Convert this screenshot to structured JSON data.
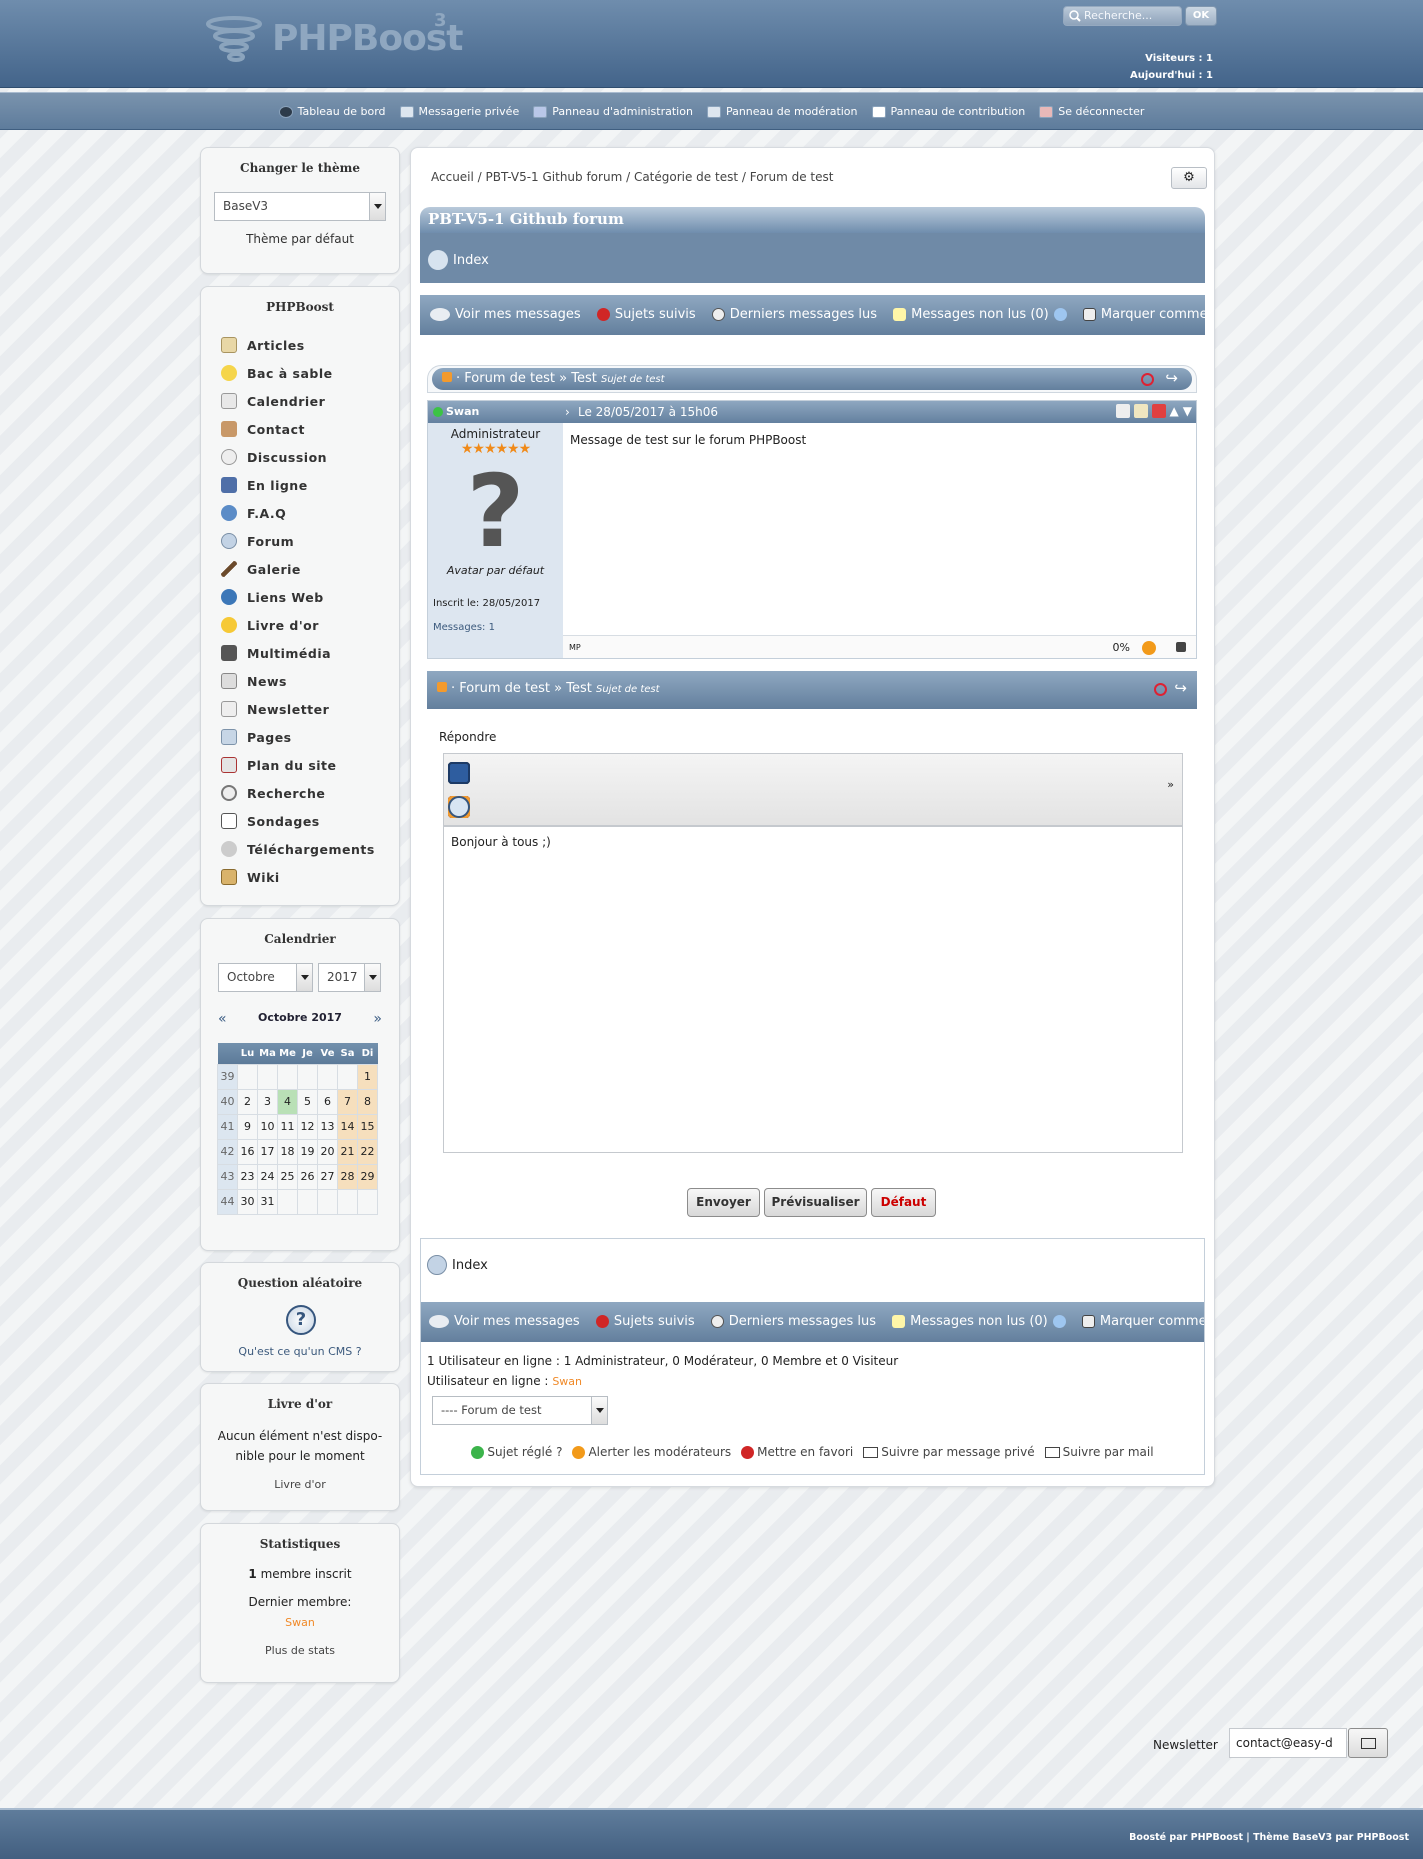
{
  "header": {
    "logo_text": "PHPBoost",
    "logo_sup": "3",
    "search_placeholder": "Recherche...",
    "search_button": "OK",
    "visitors": "Visiteurs : 1",
    "today": "Aujourd'hui : 1"
  },
  "menu": [
    {
      "label": "Tableau de bord",
      "icon": "dashboard-icon"
    },
    {
      "label": "Messagerie privée",
      "icon": "envelope-icon"
    },
    {
      "label": "Panneau d'administration",
      "icon": "admin-icon"
    },
    {
      "label": "Panneau de modération",
      "icon": "moderation-icon"
    },
    {
      "label": "Panneau de contribution",
      "icon": "contribution-icon"
    },
    {
      "label": "Se déconnecter",
      "icon": "logout-icon"
    }
  ],
  "theme_box": {
    "title": "Changer le thème",
    "selected": "BaseV3",
    "default_link": "Thème par défaut"
  },
  "nav_box": {
    "title": "PHPBoost",
    "items": [
      "Articles",
      "Bac à sable",
      "Calendrier",
      "Contact",
      "Discussion",
      "En ligne",
      "F.A.Q",
      "Forum",
      "Galerie",
      "Liens Web",
      "Livre d'or",
      "Multimédia",
      "News",
      "Newsletter",
      "Pages",
      "Plan du site",
      "Recherche",
      "Sondages",
      "Téléchargements",
      "Wiki"
    ]
  },
  "calendar": {
    "title": "Calendrier",
    "month_select": "Octobre",
    "year_select": "2017",
    "caption": "Octobre 2017",
    "prev": "«",
    "next": "»",
    "days": [
      "Lu",
      "Ma",
      "Me",
      "Je",
      "Ve",
      "Sa",
      "Di"
    ],
    "weeks": [
      [
        "39",
        "",
        "",
        "",
        "",
        "",
        "",
        "1"
      ],
      [
        "40",
        "2",
        "3",
        "4",
        "5",
        "6",
        "7",
        "8"
      ],
      [
        "41",
        "9",
        "10",
        "11",
        "12",
        "13",
        "14",
        "15"
      ],
      [
        "42",
        "16",
        "17",
        "18",
        "19",
        "20",
        "21",
        "22"
      ],
      [
        "43",
        "23",
        "24",
        "25",
        "26",
        "27",
        "28",
        "29"
      ],
      [
        "44",
        "30",
        "31",
        "",
        "",
        "",
        "",
        ""
      ]
    ]
  },
  "question_box": {
    "title": "Question aléatoire",
    "question": "Qu'est ce qu'un CMS ?"
  },
  "guestbook_box": {
    "title": "Livre d'or",
    "text1": "Aucun élément n'est dispo-",
    "text2": "nible pour le moment",
    "link": "Livre d'or"
  },
  "stats_box": {
    "title": "Statistiques",
    "members": "membre inscrit",
    "members_count": "1",
    "last_member_label": "Dernier membre:",
    "last_member": "Swan",
    "more": "Plus de stats"
  },
  "breadcrumb": [
    "Accueil",
    "PBT-V5-1 Github forum",
    "Catégorie de test",
    "Forum de test"
  ],
  "forum": {
    "title": "PBT-V5-1 Github forum",
    "index": "Index",
    "links": [
      "Voir mes messages",
      "Sujets suivis",
      "Derniers messages lus",
      "Messages non lus (0)",
      "Marquer comme lu"
    ],
    "topic_path_forum": "Forum de test",
    "topic_sep": "»",
    "topic_title": "Test",
    "topic_desc": "Sujet de test"
  },
  "post": {
    "author": "Swan",
    "date": "Le 28/05/2017 à 15h06",
    "rank": "Administrateur",
    "avatar_caption": "Avatar par défaut",
    "registered": "Inscrit le: 28/05/2017",
    "messages": "Messages: 1",
    "content": "Message de test sur le forum PHPBoost",
    "mp": "MP",
    "warning": "0%"
  },
  "reply": {
    "label": "Répondre",
    "text": "Bonjour à tous ;)",
    "send": "Envoyer",
    "preview": "Prévisualiser",
    "reset": "Défaut"
  },
  "bottom": {
    "online": "1 Utilisateur en ligne : 1 Administrateur, 0 Modérateur, 0 Membre et 0 Visiteur",
    "online_label": "Utilisateur en ligne :",
    "online_user": "Swan",
    "jump_select": "---- Forum de test",
    "actions": [
      "Sujet réglé ?",
      "Alerter les modérateurs",
      "Mettre en favori",
      "Suivre par message privé",
      "Suivre par mail"
    ]
  },
  "newsletter": {
    "label": "Newsletter",
    "value": "contact@easy-d"
  },
  "footer": {
    "text": "Boosté par PHPBoost | Thème BaseV3 par PHPBoost"
  }
}
